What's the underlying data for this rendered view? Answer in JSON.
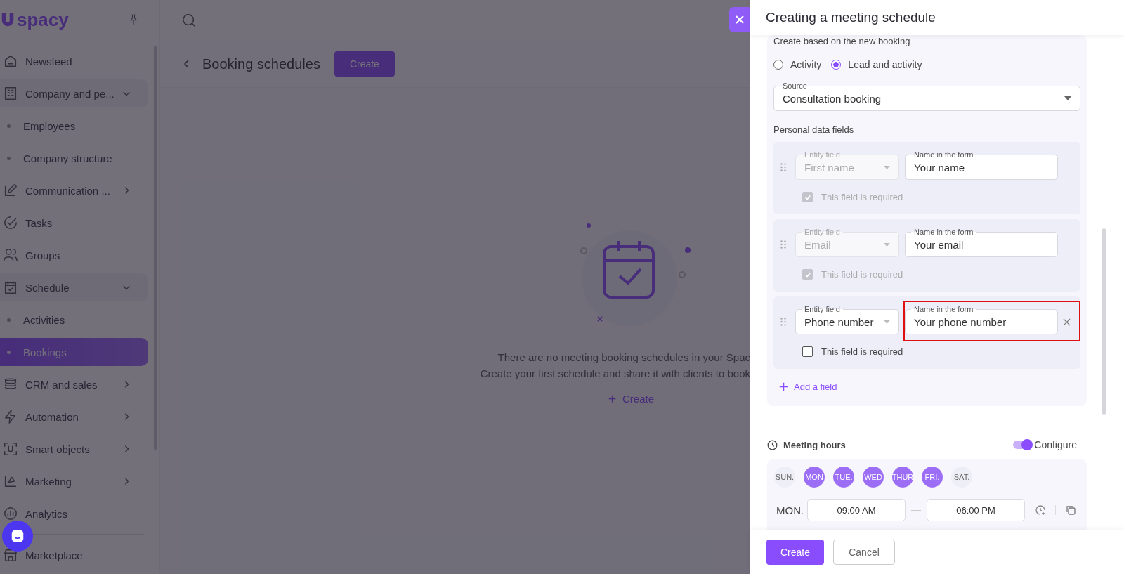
{
  "sidebar": {
    "logo": "spacy",
    "items": [
      {
        "label": "Newsfeed",
        "kind": "link",
        "selected": false
      },
      {
        "label": "Company and pe...",
        "kind": "group",
        "expanded": true,
        "selected": false,
        "children": [
          {
            "label": "Employees",
            "selected": false
          },
          {
            "label": "Company structure",
            "selected": false
          }
        ]
      },
      {
        "label": "Communication ...",
        "kind": "group",
        "expanded": false,
        "selected": false
      },
      {
        "label": "Tasks",
        "kind": "link",
        "selected": false
      },
      {
        "label": "Groups",
        "kind": "link",
        "selected": false
      },
      {
        "label": "Schedule",
        "kind": "group",
        "expanded": true,
        "selected": false,
        "children": [
          {
            "label": "Activities",
            "selected": false
          },
          {
            "label": "Bookings",
            "selected": true
          }
        ]
      },
      {
        "label": "CRM and sales",
        "kind": "group",
        "expanded": false,
        "selected": false
      },
      {
        "label": "Automation",
        "kind": "group",
        "expanded": false,
        "selected": false
      },
      {
        "label": "Smart objects",
        "kind": "group",
        "expanded": false,
        "selected": false
      },
      {
        "label": "Marketing",
        "kind": "group",
        "expanded": false,
        "selected": false
      },
      {
        "label": "Analytics",
        "kind": "link",
        "selected": false
      },
      {
        "label": "Marketplace",
        "kind": "link",
        "selected": false
      }
    ]
  },
  "header": {
    "title": "Booking schedules",
    "create_button": "Create"
  },
  "empty_state": {
    "lines": [
      "There are no meeting booking schedules in your Spac",
      "Create your first schedule and share it with clients to book"
    ],
    "create_link": "Create"
  },
  "panel": {
    "title": "Creating a meeting schedule",
    "section_heading": "Create based on the new booking",
    "entity_options": [
      {
        "label": "Activity",
        "selected": false
      },
      {
        "label": "Lead and activity",
        "selected": true
      }
    ],
    "source": {
      "label": "Source",
      "value": "Consultation booking"
    },
    "personal_data_title": "Personal data fields",
    "fields": [
      {
        "entity_label": "Entity field",
        "entity_value": "First name",
        "name_label": "Name in the form",
        "name_value": "Your name",
        "required_label": "This field is required",
        "required": true,
        "disabled": true,
        "removable": false,
        "highlighted": false
      },
      {
        "entity_label": "Entity field",
        "entity_value": "Email",
        "name_label": "Name in the form",
        "name_value": "Your email",
        "required_label": "This field is required",
        "required": true,
        "disabled": true,
        "removable": false,
        "highlighted": false
      },
      {
        "entity_label": "Entity field",
        "entity_value": "Phone number",
        "name_label": "Name in the form",
        "name_value": "Your phone number",
        "required_label": "This field is required",
        "required": false,
        "disabled": false,
        "removable": true,
        "highlighted": true
      }
    ],
    "add_field": "Add a field",
    "meeting_hours": {
      "title": "Meeting hours",
      "configure": {
        "label": "Configure",
        "on": true
      },
      "days": [
        {
          "label": "SUN.",
          "selected": false
        },
        {
          "label": "MON",
          "selected": true
        },
        {
          "label": "TUE.",
          "selected": true
        },
        {
          "label": "WED",
          "selected": true
        },
        {
          "label": "THUR",
          "selected": true
        },
        {
          "label": "FRI.",
          "selected": true
        },
        {
          "label": "SAT.",
          "selected": false
        }
      ],
      "times": [
        {
          "day": "MON.",
          "from": "09:00 AM",
          "to": "06:00 PM"
        }
      ]
    }
  },
  "footer": {
    "create": "Create",
    "cancel": "Cancel"
  }
}
